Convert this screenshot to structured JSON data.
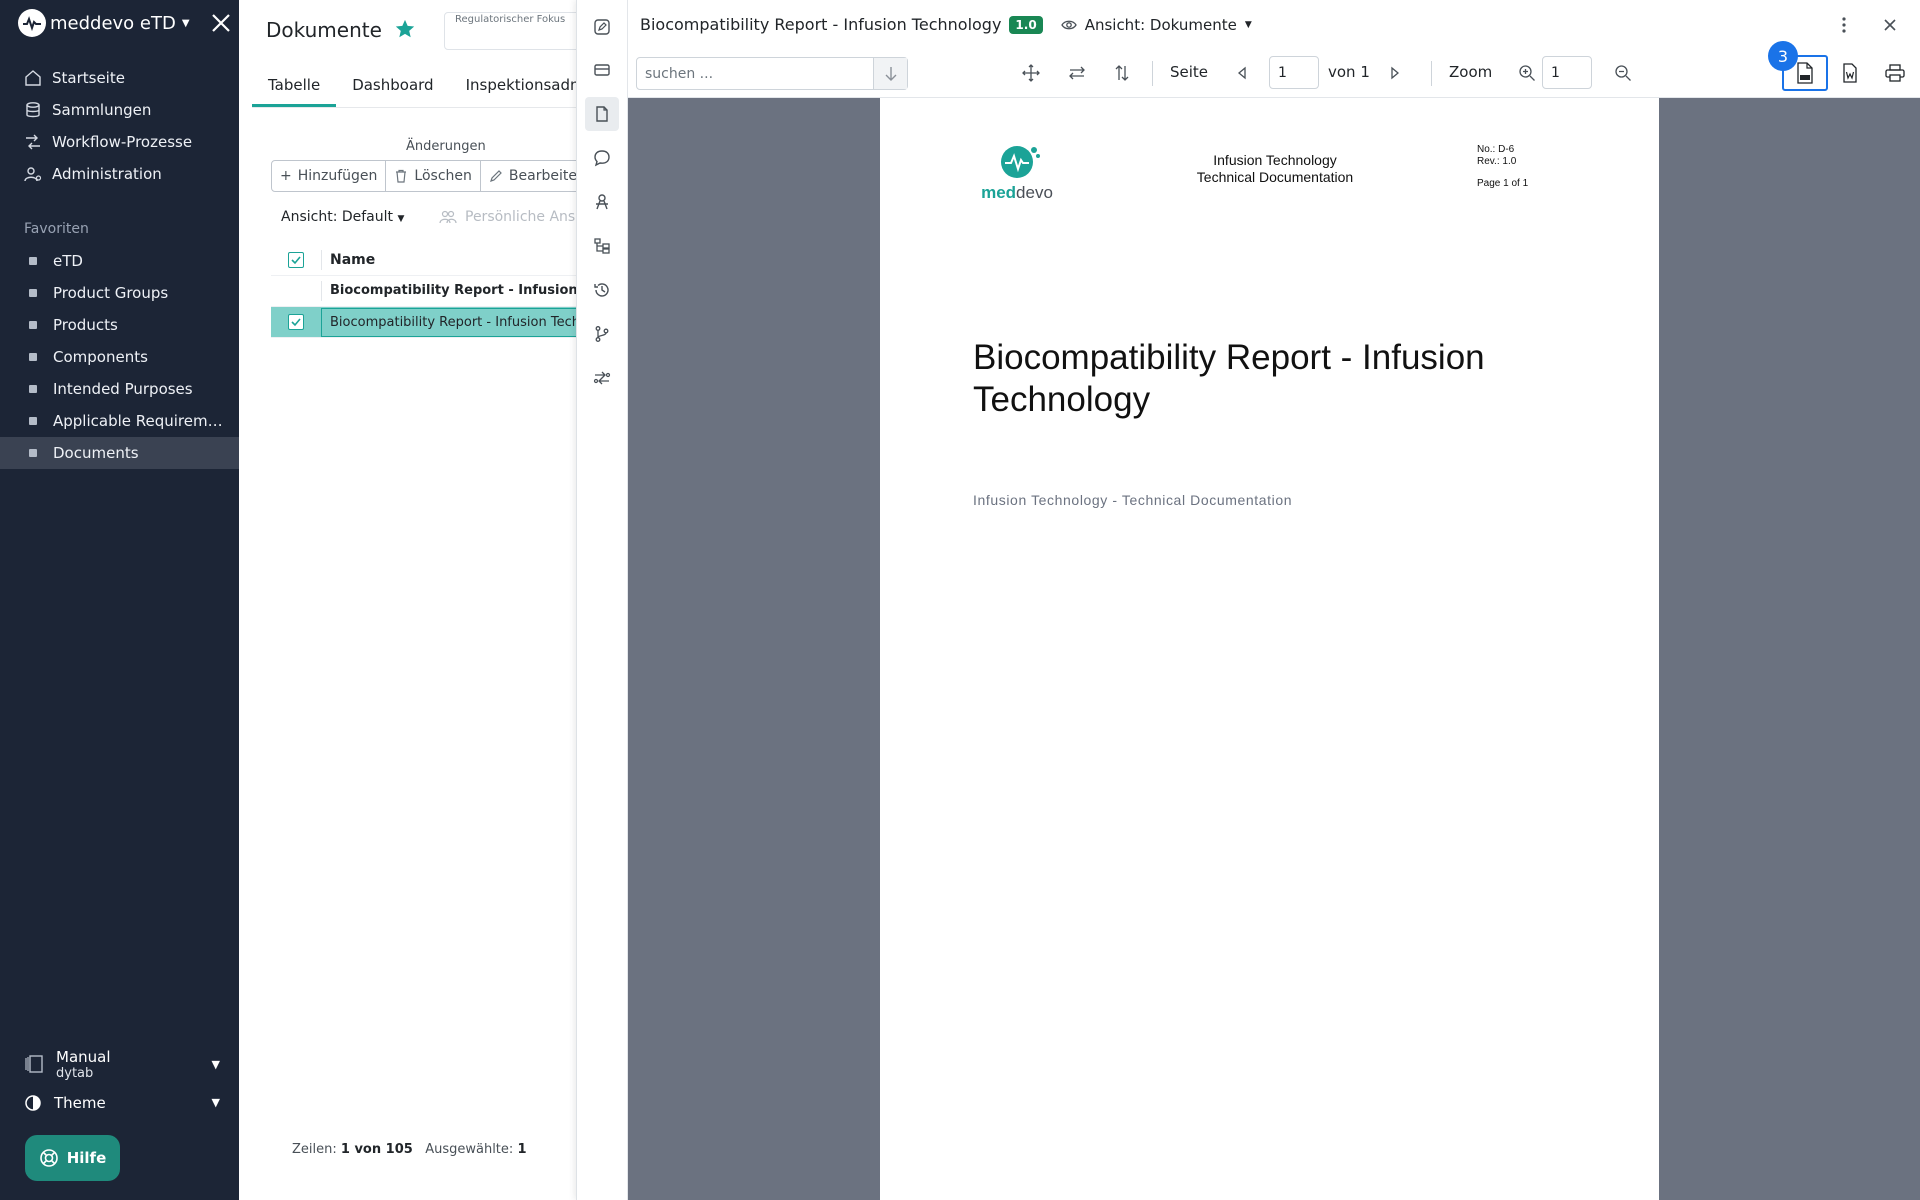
{
  "sidebar": {
    "app_name": "meddevo eTD",
    "nav": [
      {
        "label": "Startseite",
        "icon": "home-icon"
      },
      {
        "label": "Sammlungen",
        "icon": "database-icon"
      },
      {
        "label": "Workflow-Prozesse",
        "icon": "workflow-icon"
      },
      {
        "label": "Administration",
        "icon": "user-settings-icon"
      }
    ],
    "favorites_heading": "Favoriten",
    "favorites": [
      "eTD",
      "Product Groups",
      "Products",
      "Components",
      "Intended Purposes",
      "Applicable Requirem…",
      "Documents"
    ],
    "active_favorite": "Documents",
    "workspace_label": "Manual",
    "workspace_sub": "dytab",
    "theme_label": "Theme",
    "help_label": "Hilfe"
  },
  "list": {
    "title": "Dokumente",
    "regulatory_focus_label": "Regulatorischer Fokus",
    "tabs": [
      "Tabelle",
      "Dashboard",
      "Inspektionsadministration"
    ],
    "changes_label": "Änderungen",
    "add_label": "Hinzufügen",
    "delete_label": "Löschen",
    "edit_label": "Bearbeiten",
    "view_label": "Ansicht: Default",
    "personal_label": "Persönliche Ansicht",
    "column_name": "Name",
    "rows": [
      "Biocompatibility Report - Infusion Technology",
      "Biocompatibility Report - Infusion Technology"
    ],
    "footer_rows_label": "Zeilen:",
    "footer_rows_value": "1 von 105",
    "footer_selected_label": "Ausgewählte:",
    "footer_selected_value": "1"
  },
  "viewer": {
    "doc_title": "Biocompatibility Report - Infusion Technology",
    "version": "1.0",
    "view_label": "Ansicht: Dokumente",
    "search_placeholder": "suchen ...",
    "page_label": "Seite",
    "page_value": "1",
    "page_total": "von 1",
    "zoom_label": "Zoom",
    "zoom_value": "1",
    "notification_count": "3"
  },
  "pdf": {
    "logo_med": "med",
    "logo_devo": "devo",
    "header_line1": "Infusion Technology",
    "header_line2": "Technical Documentation",
    "doc_no": "No.: D-6",
    "rev": "Rev.: 1.0",
    "page_of": "Page 1 of 1",
    "title": "Biocompatibility Report - Infusion Technology",
    "subtitle": "Infusion Technology - Technical Documentation"
  },
  "colors": {
    "sidebar_bg": "#1c2536",
    "accent": "#1ba397",
    "badge_green": "#198754",
    "highlight_blue": "#1a73e8",
    "viewer_canvas": "#6b7280"
  }
}
